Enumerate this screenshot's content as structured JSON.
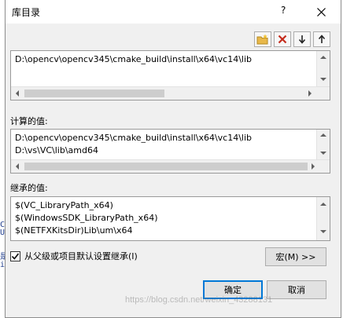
{
  "dialog": {
    "title": "库目录",
    "help_label": "?"
  },
  "directories": {
    "lines": [
      "D:\\opencv\\opencv345\\cmake_build\\install\\x64\\vc14\\lib"
    ]
  },
  "computed": {
    "label": "计算的值:",
    "lines": [
      "D:\\opencv\\opencv345\\cmake_build\\install\\x64\\vc14\\lib",
      "D:\\vs\\VC\\lib\\amd64"
    ]
  },
  "inherited": {
    "label": "继承的值:",
    "lines": [
      "$(VC_LibraryPath_x64)",
      "$(WindowsSDK_LibraryPath_x64)",
      "$(NETFXKitsDir)Lib\\um\\x64"
    ]
  },
  "inherit_option": {
    "label": "从父级或项目默认设置继承(I)",
    "checked": true
  },
  "buttons": {
    "macro": "宏(M) >>",
    "ok": "确定",
    "cancel": "取消"
  },
  "watermark": "https://blog.csdn.net/weixin_43288131",
  "colors": {
    "accent": "#0078d7",
    "delete_icon": "#c42b1c",
    "new_folder_icon": "#d9a227"
  },
  "background_fragments": [
    "C",
    "U",
    "是",
    "i"
  ]
}
